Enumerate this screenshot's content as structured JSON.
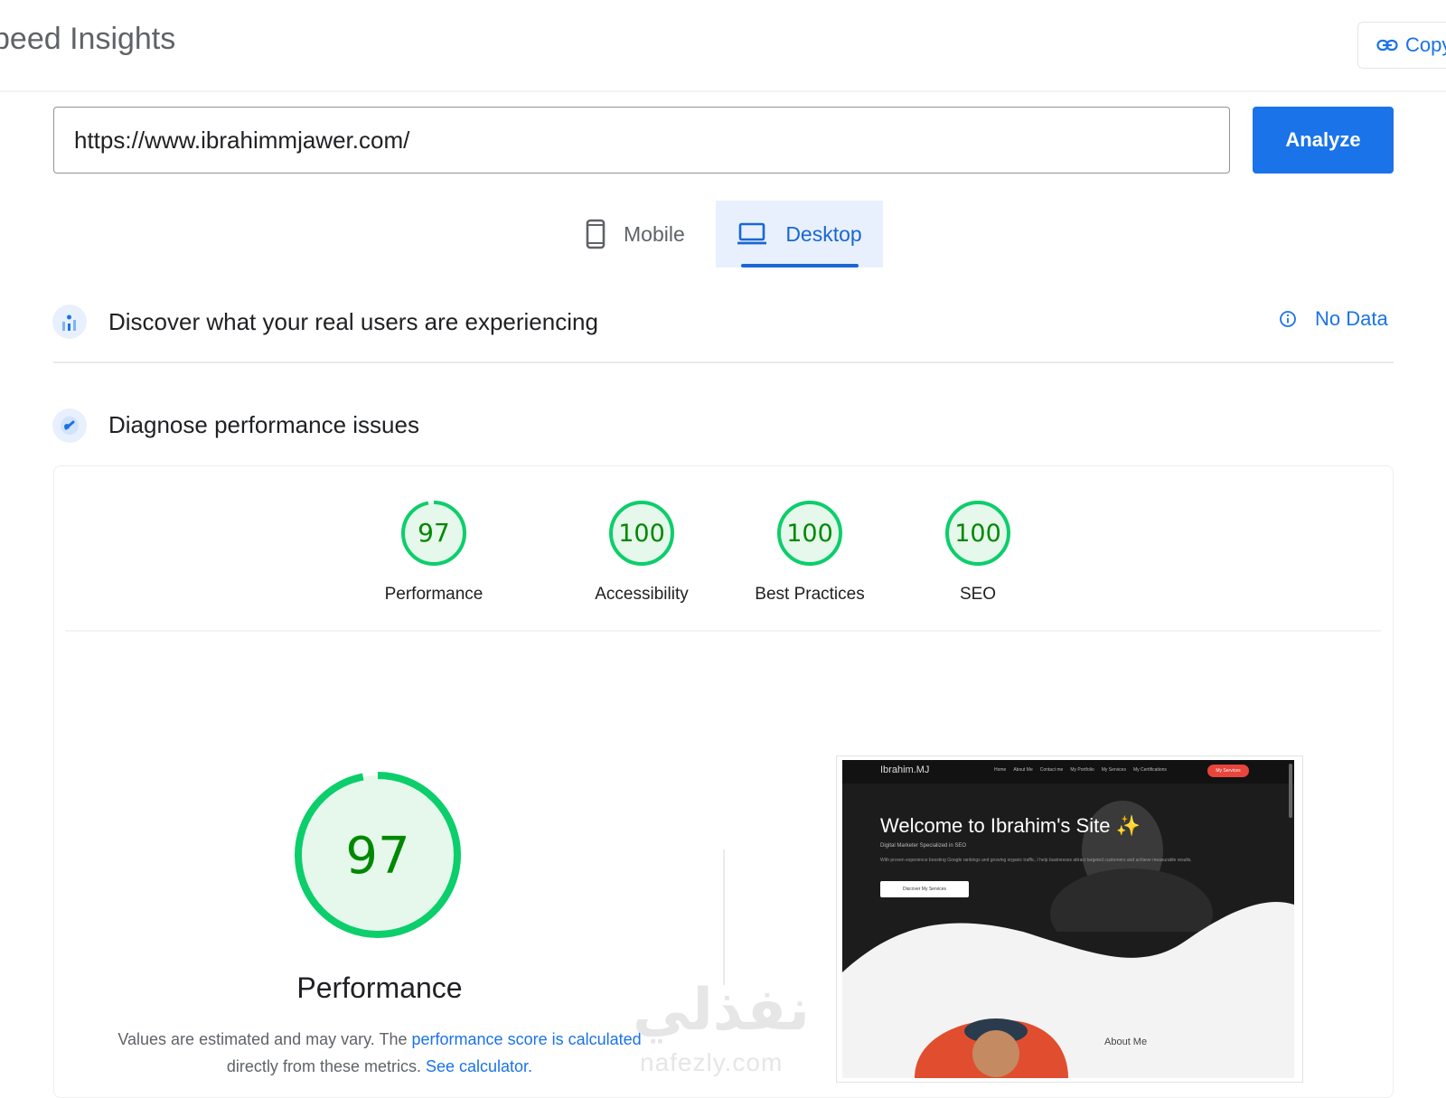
{
  "header": {
    "title": "peed Insights",
    "copy_label": "Copy"
  },
  "analyze_form": {
    "url_value": "https://www.ibrahimmjawer.com/",
    "analyze_label": "Analyze"
  },
  "device_tabs": {
    "mobile_label": "Mobile",
    "desktop_label": "Desktop",
    "selected": "Desktop"
  },
  "field_data": {
    "title": "Discover what your real users are experiencing",
    "status": "No Data"
  },
  "lab_data": {
    "title": "Diagnose performance issues"
  },
  "scores": [
    {
      "label": "Performance",
      "value": "97"
    },
    {
      "label": "Accessibility",
      "value": "100"
    },
    {
      "label": "Best Practices",
      "value": "100"
    },
    {
      "label": "SEO",
      "value": "100"
    }
  ],
  "performance_detail": {
    "score": "97",
    "score_fraction": 0.97,
    "title": "Performance",
    "desc_prefix": "Values are estimated and may vary. The ",
    "desc_link": "performance score is calculated",
    "desc_middle": "directly from these metrics. ",
    "desc_link2": "See calculator."
  },
  "screenshot_preview": {
    "site_name": "Ibrahim.MJ",
    "nav_items": [
      "Home",
      "About Me",
      "Contact me",
      "My Portfolio",
      "My Services",
      "My Certifications"
    ],
    "nav_button": "My Services",
    "headline": "Welcome to Ibrahim's Site ✨",
    "subtitle": "Digital Marketer Specialized in SEO",
    "body": "With proven experience boosting Google rankings and growing organic traffic, I help businesses attract targeted customers and achieve measurable results.",
    "cta": "Discover My Services",
    "section_label": "About Me"
  },
  "watermark": {
    "arabic": "نفذلي",
    "latin": "nafezly.com"
  },
  "colors": {
    "accent": "#1a73e8",
    "pass_green": "#0cce6b",
    "pass_text": "#008800",
    "pass_fill": "#e6f8ec"
  }
}
